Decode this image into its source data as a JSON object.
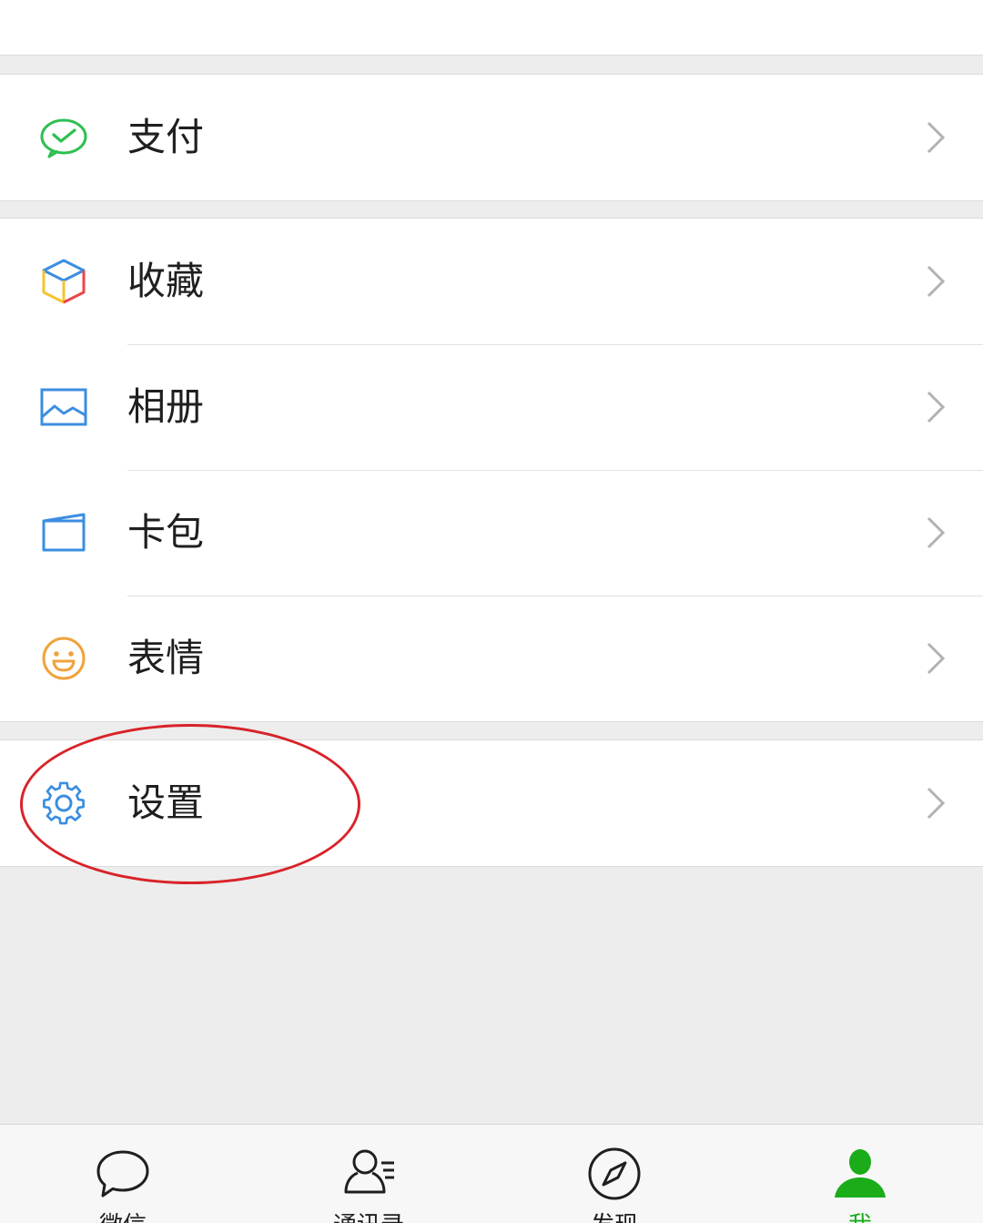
{
  "menu": {
    "groups": [
      {
        "items": [
          {
            "label": "支付",
            "icon": "wechat-pay-icon"
          }
        ]
      },
      {
        "items": [
          {
            "label": "收藏",
            "icon": "favorites-cube-icon"
          },
          {
            "label": "相册",
            "icon": "album-picture-icon"
          },
          {
            "label": "卡包",
            "icon": "card-wallet-icon"
          },
          {
            "label": "表情",
            "icon": "emoji-smiley-icon"
          }
        ]
      },
      {
        "items": [
          {
            "label": "设置",
            "icon": "gear-icon"
          }
        ]
      }
    ]
  },
  "tabbar": {
    "tabs": [
      {
        "label": "微信",
        "icon": "chat-bubble-icon",
        "active": false
      },
      {
        "label": "通讯录",
        "icon": "contacts-icon",
        "active": false
      },
      {
        "label": "发现",
        "icon": "compass-icon",
        "active": false
      },
      {
        "label": "我",
        "icon": "person-icon",
        "active": true
      }
    ]
  },
  "colors": {
    "accent_green": "#1aad19",
    "annotation_red": "#d8232a",
    "background": "#ededed"
  }
}
